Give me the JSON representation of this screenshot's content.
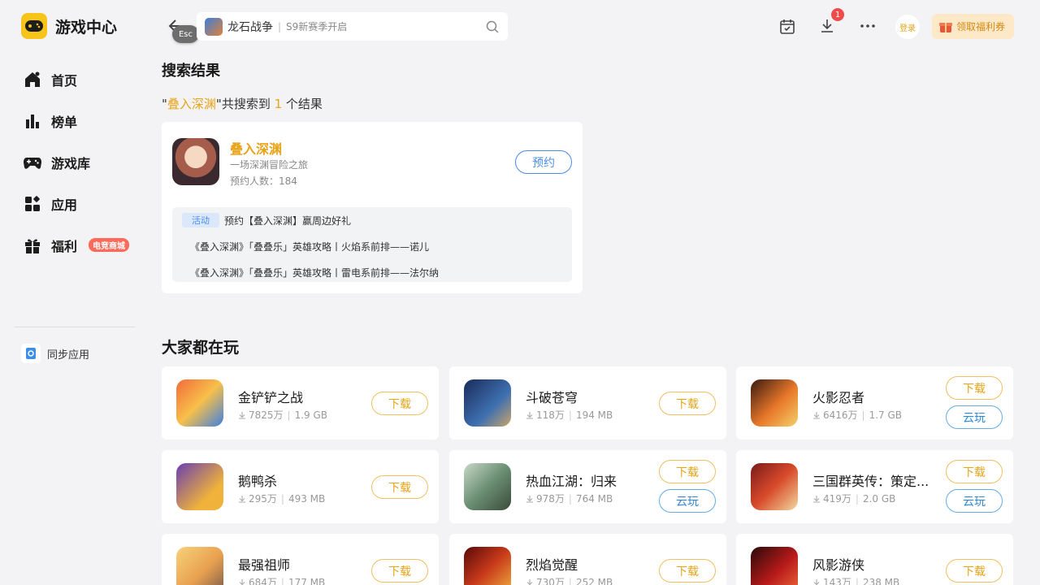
{
  "app": {
    "title": "游戏中心"
  },
  "sidebar": {
    "items": [
      {
        "label": "首页",
        "icon": "home-icon"
      },
      {
        "label": "榜单",
        "icon": "chart-icon"
      },
      {
        "label": "游戏库",
        "icon": "gamepad-icon"
      },
      {
        "label": "应用",
        "icon": "apps-icon"
      },
      {
        "label": "福利",
        "icon": "gift-icon",
        "badge": "电竞商城"
      }
    ],
    "sync_label": "同步应用"
  },
  "topbar": {
    "esc_label": "Esc",
    "search_term": "龙石战争",
    "search_hint": "S9新赛季开启",
    "download_count": "1",
    "login_label": "登录",
    "coupon_label": "领取福利券"
  },
  "results": {
    "title": "搜索结果",
    "quote_open": "\"",
    "query": "叠入深渊",
    "mid_text": "\"共搜索到 ",
    "count": "1",
    "tail_text": " 个结果",
    "card": {
      "name": "叠入深渊",
      "desc": "一场深渊冒险之旅",
      "reserve_count": "预约人数：184",
      "reserve_label": "预约",
      "activity_tag": "活动",
      "activities": [
        "预约【叠入深渊】赢周边好礼",
        "《叠入深渊》「叠叠乐」英雄攻略丨火焰系前排——诺儿",
        "《叠入深渊》「叠叠乐」英雄攻略丨雷电系前排——法尔纳"
      ]
    }
  },
  "popular": {
    "title": "大家都在玩",
    "download_label": "下载",
    "cloud_label": "云玩",
    "games": [
      {
        "name": "金铲铲之战",
        "downloads": "7825万",
        "size": "1.9 GB",
        "cloud": false
      },
      {
        "name": "斗破苍穹",
        "downloads": "118万",
        "size": "194 MB",
        "cloud": false
      },
      {
        "name": "火影忍者",
        "downloads": "6416万",
        "size": "1.7 GB",
        "cloud": true
      },
      {
        "name": "鹅鸭杀",
        "downloads": "295万",
        "size": "493 MB",
        "cloud": false
      },
      {
        "name": "热血江湖：归来",
        "downloads": "978万",
        "size": "764 MB",
        "cloud": true
      },
      {
        "name": "三国群英传：策定...",
        "downloads": "419万",
        "size": "2.0 GB",
        "cloud": true
      },
      {
        "name": "最强祖师",
        "downloads": "684万",
        "size": "177 MB",
        "cloud": false
      },
      {
        "name": "烈焰觉醒",
        "downloads": "730万",
        "size": "252 MB",
        "cloud": false
      },
      {
        "name": "风影游侠",
        "downloads": "143万",
        "size": "238 MB",
        "cloud": false
      }
    ]
  },
  "colors": {
    "accent": "#e8a317",
    "blue": "#4b8de8",
    "background": "#f3f3f5"
  }
}
